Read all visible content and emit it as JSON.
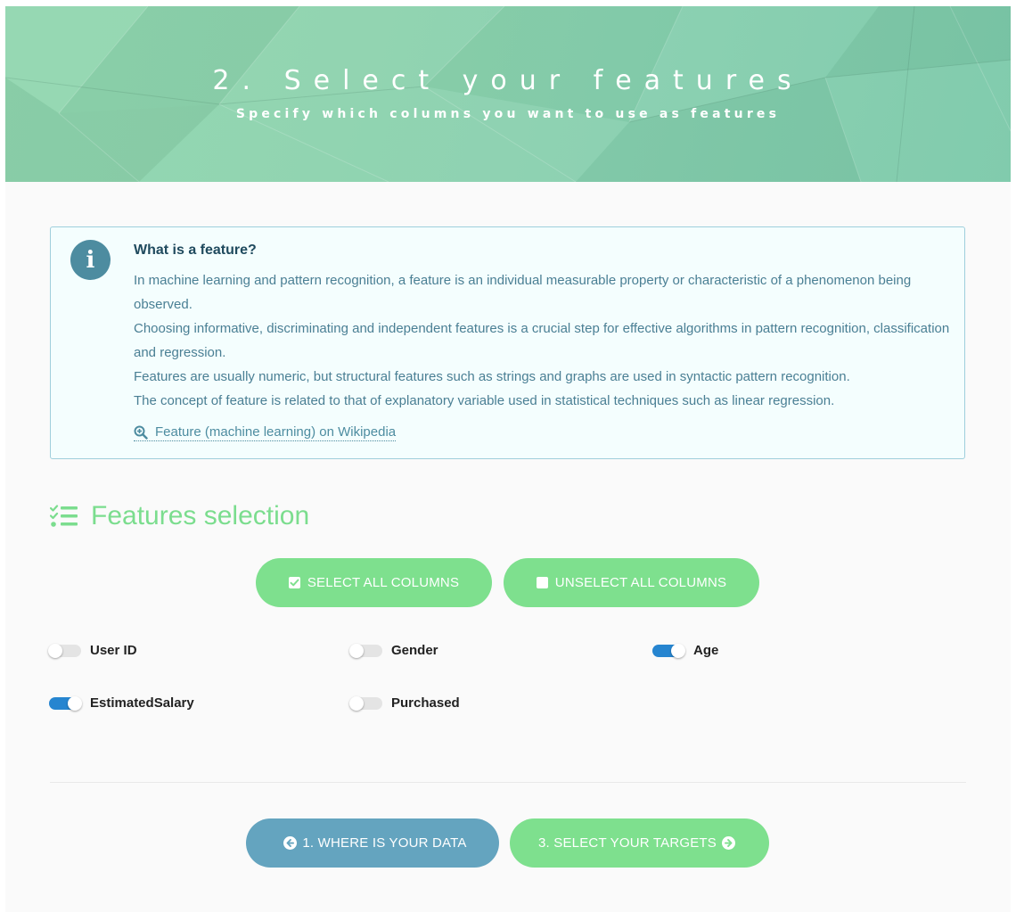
{
  "hero": {
    "title": "2. Select your features",
    "subtitle": "Specify which columns you want to use as features"
  },
  "info": {
    "icon": "info-icon",
    "title": "What is a feature?",
    "paragraphs": [
      "In machine learning and pattern recognition, a feature is an individual measurable property or characteristic of a phenomenon being observed.",
      "Choosing informative, discriminating and independent features is a crucial step for effective algorithms in pattern recognition, classification and regression.",
      "Features are usually numeric, but structural features such as strings and graphs are used in syntactic pattern recognition.",
      "The concept of feature is related to that of explanatory variable used in statistical techniques such as linear regression."
    ],
    "link_icon": "search-plus-icon",
    "link_label": "Feature (machine learning) on Wikipedia"
  },
  "features": {
    "heading_icon": "tasks-icon",
    "heading": "Features selection",
    "select_all_label": "SELECT ALL COLUMNS",
    "unselect_all_label": "UNSELECT ALL COLUMNS",
    "columns": [
      {
        "name": "User ID",
        "selected": false
      },
      {
        "name": "Gender",
        "selected": false
      },
      {
        "name": "Age",
        "selected": true
      },
      {
        "name": "EstimatedSalary",
        "selected": true
      },
      {
        "name": "Purchased",
        "selected": false
      }
    ]
  },
  "nav": {
    "prev_label": "1. WHERE IS YOUR DATA",
    "prev_icon": "arrow-circle-left-icon",
    "next_label": "3. SELECT YOUR TARGETS",
    "next_icon": "arrow-circle-right-icon"
  },
  "colors": {
    "accent_green": "#7ee08e",
    "nav_blue": "#64a4bf",
    "toggle_on": "#2685d0",
    "info_icon_bg": "#4d8ca0"
  }
}
